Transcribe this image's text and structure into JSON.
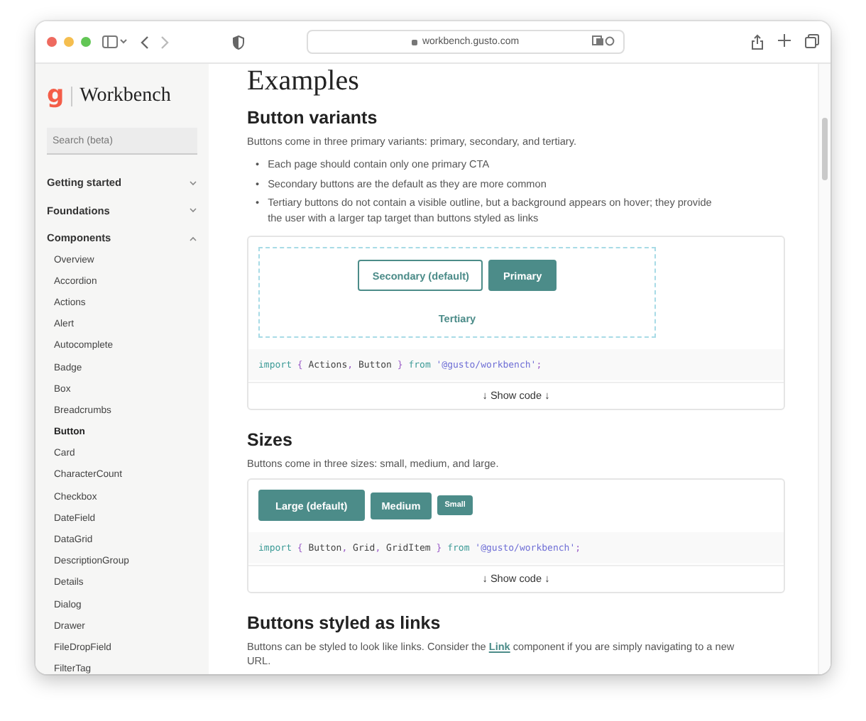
{
  "browser": {
    "url": "workbench.gusto.com"
  },
  "sidebar": {
    "logo": "g",
    "title": "Workbench",
    "search": {
      "placeholder": "Search (beta)"
    },
    "groups": [
      {
        "label": "Getting started",
        "expanded": false
      },
      {
        "label": "Foundations",
        "expanded": false
      },
      {
        "label": "Components",
        "expanded": true,
        "items": [
          {
            "label": "Overview",
            "selected": false
          },
          {
            "label": "Accordion",
            "selected": false
          },
          {
            "label": "Actions",
            "selected": false
          },
          {
            "label": "Alert",
            "selected": false
          },
          {
            "label": "Autocomplete",
            "selected": false
          },
          {
            "label": "Badge",
            "selected": false
          },
          {
            "label": "Box",
            "selected": false
          },
          {
            "label": "Breadcrumbs",
            "selected": false
          },
          {
            "label": "Button",
            "selected": true
          },
          {
            "label": "Card",
            "selected": false
          },
          {
            "label": "CharacterCount",
            "selected": false
          },
          {
            "label": "Checkbox",
            "selected": false
          },
          {
            "label": "DateField",
            "selected": false
          },
          {
            "label": "DataGrid",
            "selected": false
          },
          {
            "label": "DescriptionGroup",
            "selected": false
          },
          {
            "label": "Details",
            "selected": false
          },
          {
            "label": "Dialog",
            "selected": false
          },
          {
            "label": "Drawer",
            "selected": false
          },
          {
            "label": "FileDropField",
            "selected": false
          },
          {
            "label": "FilterTag",
            "selected": false
          }
        ]
      }
    ]
  },
  "content": {
    "title": "Examples",
    "sections": [
      {
        "heading": "Button variants",
        "description": "Buttons come in three primary variants: primary, secondary, and tertiary.",
        "bullets": [
          {
            "marker": "•",
            "text": "Each page should contain only one primary CTA"
          },
          {
            "marker": "•",
            "text": "Secondary buttons are the default as they are more common"
          },
          {
            "marker": "•",
            "text": "Tertiary buttons do not contain a visible outline, but a background appears on hover; they provide the user with a larger tap target than buttons styled as links"
          }
        ],
        "demo": {
          "kind": "variants",
          "buttons": [
            {
              "label": "Secondary (default)",
              "kind": "secondary"
            },
            {
              "label": "Primary",
              "kind": "primary"
            },
            {
              "label": "Tertiary",
              "kind": "tertiary"
            }
          ],
          "code": [
            {
              "text": "import",
              "kind": "keyword"
            },
            {
              "text": " { ",
              "kind": "punct"
            },
            {
              "text": "Actions",
              "kind": "name"
            },
            {
              "text": ", ",
              "kind": "punct"
            },
            {
              "text": "Button",
              "kind": "name"
            },
            {
              "text": " } ",
              "kind": "punct"
            },
            {
              "text": "from",
              "kind": "keyword"
            },
            {
              "text": " '@gusto/workbench'",
              "kind": "string"
            },
            {
              "text": ";",
              "kind": "punct"
            }
          ],
          "show_code": "↓ Show code ↓"
        }
      },
      {
        "heading": "Sizes",
        "description": "Buttons come in three sizes: small, medium, and large.",
        "demo": {
          "kind": "sizes",
          "buttons": [
            {
              "label": "Large (default)",
              "kind": "large"
            },
            {
              "label": "Medium",
              "kind": "medium"
            },
            {
              "label": "Small",
              "kind": "small"
            }
          ],
          "code": [
            {
              "text": "import",
              "kind": "keyword"
            },
            {
              "text": " { ",
              "kind": "punct"
            },
            {
              "text": "Button",
              "kind": "name"
            },
            {
              "text": ", ",
              "kind": "punct"
            },
            {
              "text": "Grid",
              "kind": "name"
            },
            {
              "text": ", ",
              "kind": "punct"
            },
            {
              "text": "GridItem",
              "kind": "name"
            },
            {
              "text": " } ",
              "kind": "punct"
            },
            {
              "text": "from",
              "kind": "keyword"
            },
            {
              "text": " '@gusto/workbench'",
              "kind": "string"
            },
            {
              "text": ";",
              "kind": "punct"
            }
          ],
          "show_code": "↓ Show code ↓"
        }
      },
      {
        "heading": "Buttons styled as links",
        "description": [
          {
            "kind": "text",
            "text": "Buttons can be styled to look like links. Consider the "
          },
          {
            "kind": "link",
            "text": "Link"
          },
          {
            "kind": "text",
            "text": " component if you are simply navigating to a new URL."
          }
        ],
        "demo": {
          "kind": "cut"
        }
      }
    ]
  }
}
